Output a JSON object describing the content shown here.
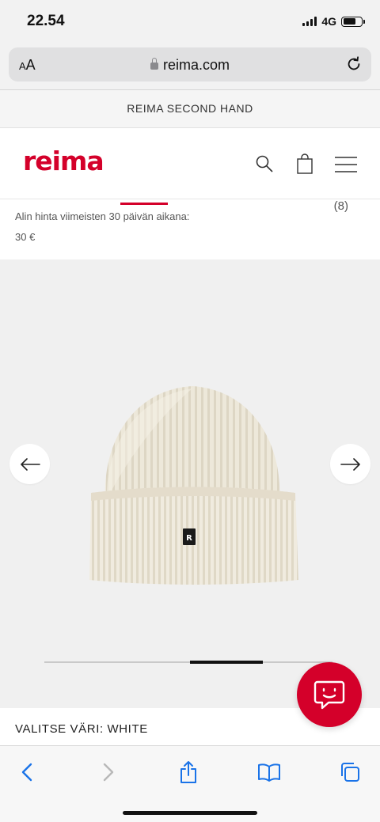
{
  "status_bar": {
    "time": "22.54",
    "network": "4G"
  },
  "browser": {
    "aa_label_small": "A",
    "aa_label": "A",
    "url": "reima.com"
  },
  "site": {
    "banner": "REIMA SECOND HAND",
    "logo": "reima",
    "reviews_count": "(8)",
    "lowest_price_label": "Alin hinta viimeisten 30 päivän aikana:",
    "lowest_price": "30 €",
    "color_label": "VALITSE VÄRI: WHITE",
    "accent_color": "#d4002a"
  },
  "icons": [
    "lock-icon",
    "reload-icon",
    "search-icon",
    "shopping-bag-icon",
    "menu-icon",
    "arrow-left-icon",
    "arrow-right-icon",
    "chat-icon",
    "back-icon",
    "forward-icon",
    "share-icon",
    "bookmarks-icon",
    "tabs-icon"
  ],
  "gallery": {
    "progress": 0.25
  }
}
